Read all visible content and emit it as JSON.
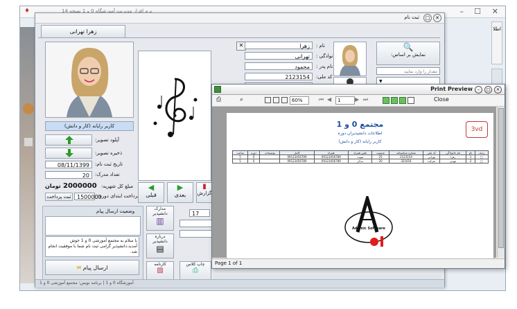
{
  "background_window": {
    "title": "نرم افزار مدیریت آموزشگاه 0 و 1 نسخه 14",
    "right_edge_label": "اطلا"
  },
  "main_window": {
    "title": "ثبت نام",
    "tab_label": "زهرا تهرانی",
    "photo_caption": "کاربر رایانه (کار و دانش)",
    "upload_label": "آپلود تصویر:",
    "save_image_label": "ذخیره تصویر:",
    "register_date_label": "تاریخ ثبت نام:",
    "register_date_value": "08/11/1399",
    "docs_count_label": "تعداد مدرک:",
    "docs_count_value": "20",
    "tuition_label": "مبلغ کل شهریه:",
    "tuition_value": "2000000",
    "currency": "تومان",
    "first_payment_label": "پرداخت ابتدای دوره:",
    "first_payment_value": "1500000",
    "pay_button": "ثبت پرداخت",
    "prev_button": "قبلی",
    "next_button": "بعدی",
    "report_button": "گزارش",
    "first_name_label": "نام :",
    "first_name_value": "زهرا",
    "last_name_label": "نام خانوادگی :",
    "last_name_value": "تهرانی",
    "father_label": "نام پدر :",
    "father_value": "محمود",
    "national_code_label": "کد ملی:",
    "national_code_value": "2123154",
    "age_value": "25",
    "search_button": "نمایش بر اساس:",
    "search_placeholder": "مقدار را وارد نمایید",
    "message_status_label": "وضعیت ارسال پیام",
    "message_text": "با سلام به مجتمع آموزشی 0 و 1 خوش آمدید.دانشپذیر گرامی ثبت نام شما با موفقیت انجام شد.",
    "send_message_button": "ارسال پیام",
    "student_docs_button": "مدارک دانشپذیر",
    "about_student_button": "درباره دانشپذیر",
    "report_card_button": "کارنامه",
    "print_class_button": "چاپ کلاس",
    "footer_text": "آموزشگاه 0 و 1   |   برنامه نویس: مجتمع آموزشی 0 و 1",
    "stepper_value": "17"
  },
  "print_preview": {
    "title": "Print Preview",
    "zoom": "60%",
    "page_number": "1",
    "close_label": "Close",
    "status": "Page 1 of 1",
    "report": {
      "title": "مجتمع 0 و 1",
      "subtitle": "اطلاعات دانشپذیران دوره",
      "course": "کاربر رایانه (کار و دانش)",
      "headers": [
        "ردیف",
        "نام",
        "نام خانوادگی",
        "کد ملی",
        "شماره شناسنامه",
        "جنسیت",
        "تلفن همراه",
        "همراه",
        "کامل",
        "شرح",
        "وضعیت"
      ],
      "rows": [
        [
          "1",
          "زهرا",
          "تهرانی",
          "2123154",
          "25",
          "مونث",
          "09123456789",
          "09123456789"
        ],
        [
          "2",
          "مهدی",
          "شرکت",
          "321654",
          "20",
          "مذکر",
          "09123456789",
          "09123456789"
        ]
      ],
      "logo_text": "Ademic Software"
    }
  }
}
